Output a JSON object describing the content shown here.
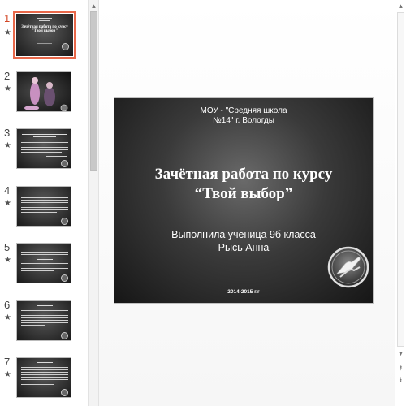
{
  "thumbnails": [
    {
      "number": "1",
      "star": "★",
      "active": true
    },
    {
      "number": "2",
      "star": "★",
      "active": false
    },
    {
      "number": "3",
      "star": "★",
      "active": false
    },
    {
      "number": "4",
      "star": "★",
      "active": false
    },
    {
      "number": "5",
      "star": "★",
      "active": false
    },
    {
      "number": "6",
      "star": "★",
      "active": false
    },
    {
      "number": "7",
      "star": "★",
      "active": false
    }
  ],
  "thumb1": {
    "title": "Зачётная работа по курсу \"Твой выбор\""
  },
  "slide": {
    "school_line1": "МОУ - \"Средняя школа",
    "school_line2": "№14\" г. Вологды",
    "title_line1": "Зачётная работа по курсу",
    "title_line2": "“Твой выбор”",
    "author_line1": "Выполнила ученица 9б класса",
    "author_line2": "Рысь Анна",
    "years": "2014-2015 г.г"
  },
  "icons": {
    "scroll_up": "scroll-up-icon",
    "scroll_down": "scroll-down-icon",
    "prev_slide": "previous-slide-icon",
    "next_slide": "next-slide-icon",
    "logo": "hands-logo"
  },
  "colors": {
    "active_accent": "#e8684a",
    "active_number": "#d24726"
  }
}
